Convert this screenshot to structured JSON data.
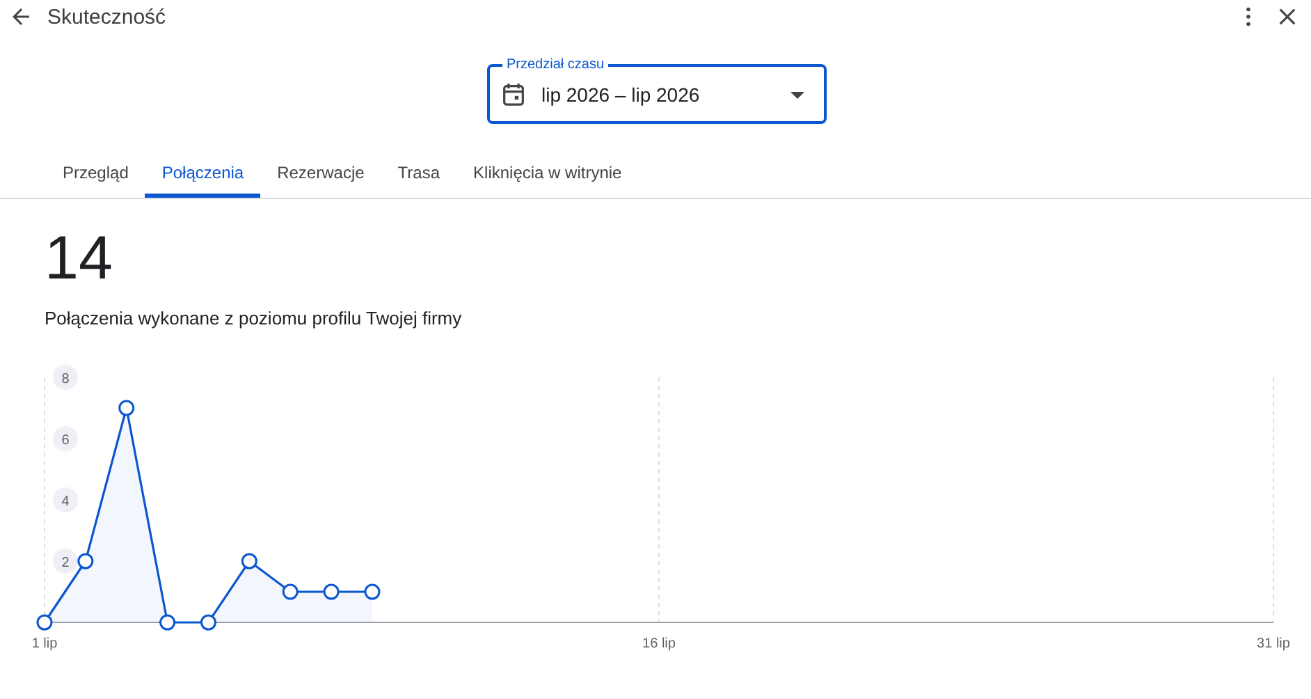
{
  "header": {
    "title": "Skuteczność"
  },
  "date_range": {
    "label": "Przedział czasu",
    "value": "lip 2026 – lip 2026"
  },
  "tabs": [
    {
      "label": "Przegląd",
      "selected": false
    },
    {
      "label": "Połączenia",
      "selected": true
    },
    {
      "label": "Rezerwacje",
      "selected": false
    },
    {
      "label": "Trasa",
      "selected": false
    },
    {
      "label": "Kliknięcia w witrynie",
      "selected": false
    }
  ],
  "summary": {
    "total": "14",
    "description": "Połączenia wykonane z poziomu profilu Twojej firmy"
  },
  "chart_data": {
    "type": "area",
    "x": [
      1,
      2,
      3,
      4,
      5,
      6,
      7,
      8,
      9
    ],
    "series": [
      {
        "color": "#0b57d0",
        "values": [
          0,
          2,
          7,
          0,
          0,
          2,
          1,
          1,
          1
        ]
      }
    ],
    "xlim": [
      1,
      31
    ],
    "ylim": [
      0,
      8
    ],
    "xticks": [
      {
        "value": 1,
        "label": "1 lip"
      },
      {
        "value": 16,
        "label": "16 lip"
      },
      {
        "value": 31,
        "label": "31 lip"
      }
    ],
    "yticks": [
      2,
      4,
      6,
      8
    ]
  }
}
